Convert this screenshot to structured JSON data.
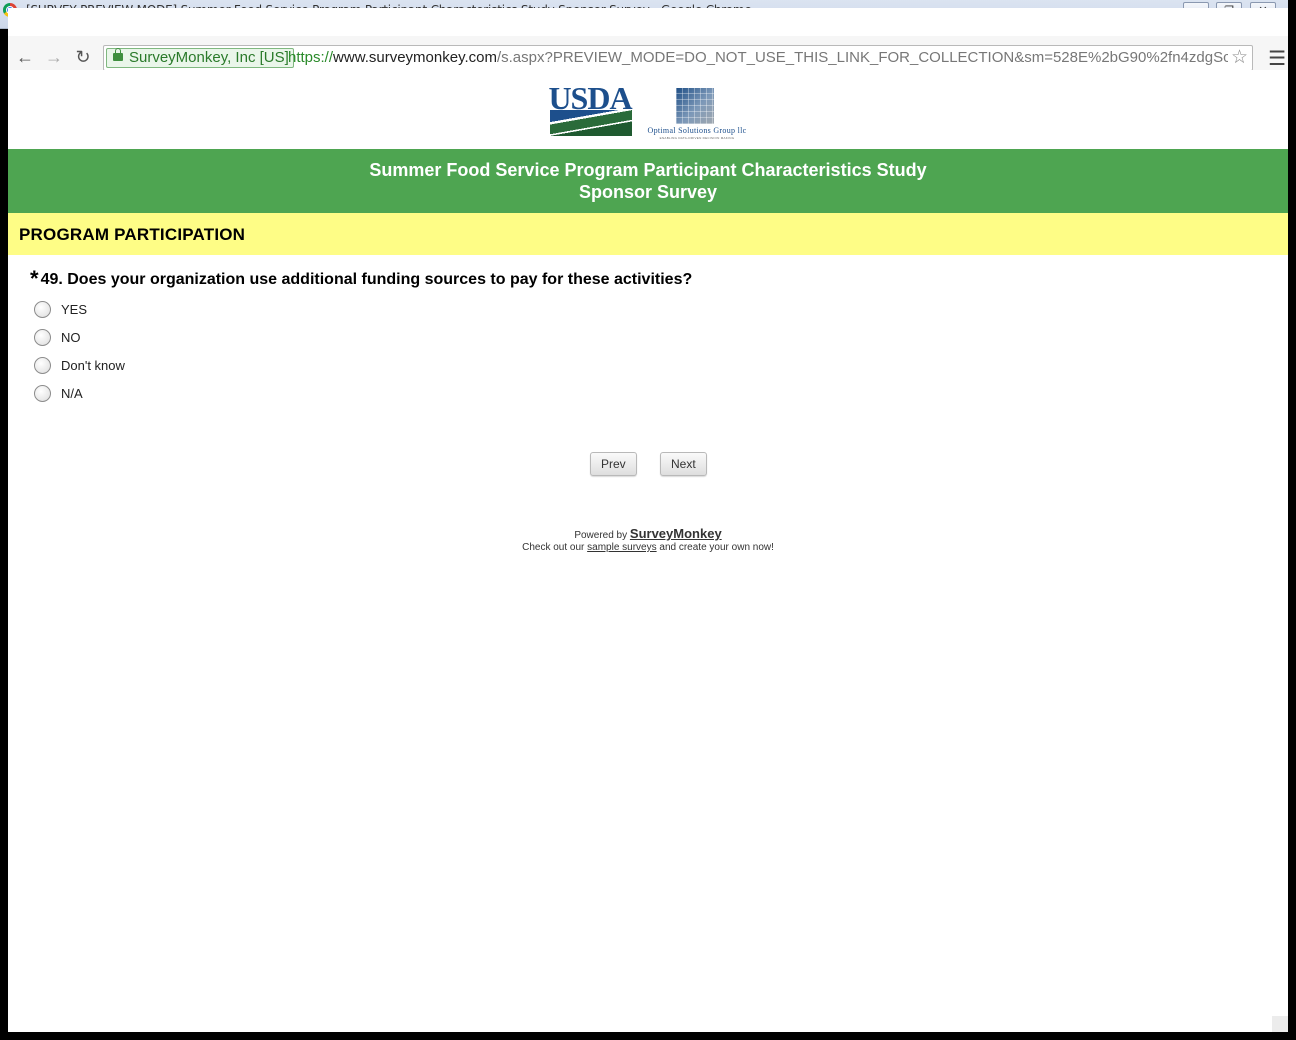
{
  "window": {
    "title": "[SURVEY PREVIEW MODE] Summer Food Service Program Participant Characteristics Study Sponsor Survey - Google Chrome"
  },
  "browser": {
    "ev_label": "SurveyMonkey, Inc [US]",
    "url_scheme": "https://",
    "url_host": "www.surveymonkey.com",
    "url_path": "/s.aspx?PREVIEW_MODE=DO_NOT_USE_THIS_LINK_FOR_COLLECTION&sm=528E%2bG90%2fn4zdgSc"
  },
  "logos": {
    "usda": "USDA",
    "optimal_name": "Optimal Solutions Group llc",
    "optimal_tagline": "ENABLING DATA-DRIVEN DECISION MAKING"
  },
  "header": {
    "title_line1": "Summer Food Service Program Participant Characteristics Study",
    "title_line2": "Sponsor Survey"
  },
  "section": {
    "title": "PROGRAM PARTICIPATION"
  },
  "question": {
    "required_marker": "*",
    "text": "49. Does your organization use additional funding sources to pay for these activities?",
    "options": [
      "YES",
      "NO",
      "Don't know",
      "N/A"
    ]
  },
  "buttons": {
    "prev": "Prev",
    "next": "Next"
  },
  "footer": {
    "powered_by": "Powered by",
    "brand": "SurveyMonkey",
    "line2_pre": "Check out our",
    "line2_link": "sample surveys",
    "line2_post": "and create your own now!"
  }
}
